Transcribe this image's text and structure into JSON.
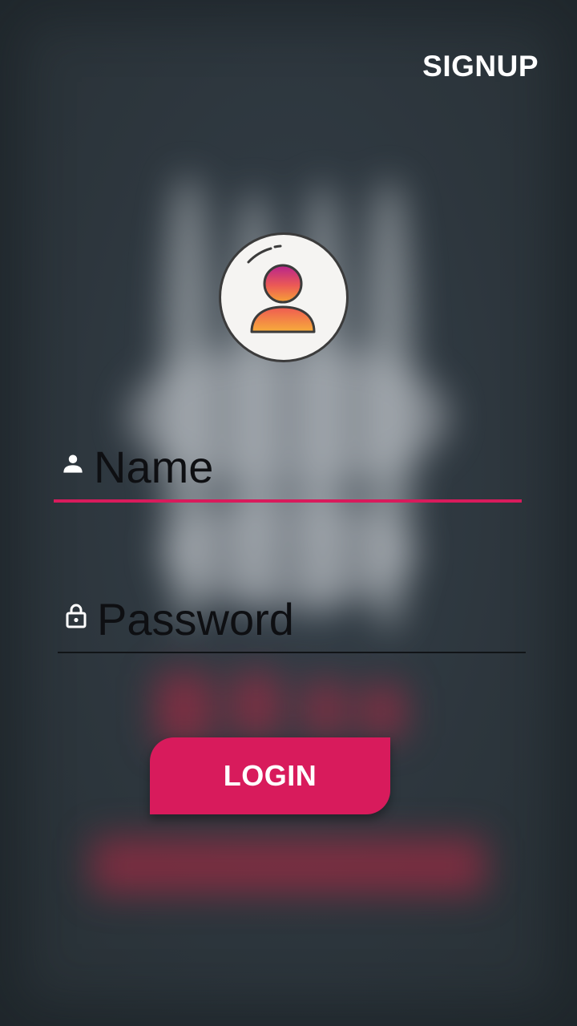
{
  "header": {
    "signup_label": "SIGNUP"
  },
  "avatar": {
    "icon": "user-avatar-icon"
  },
  "form": {
    "name": {
      "placeholder": "Name",
      "value": "",
      "icon": "person-icon"
    },
    "password": {
      "placeholder": "Password",
      "value": "",
      "icon": "lock-icon"
    },
    "login_label": "LOGIN"
  },
  "colors": {
    "accent": "#d81b5c",
    "background": "#2c353b",
    "text_on_accent": "#ffffff",
    "avatar_gradient_top": "#b7238c",
    "avatar_gradient_bottom": "#f6a237"
  }
}
